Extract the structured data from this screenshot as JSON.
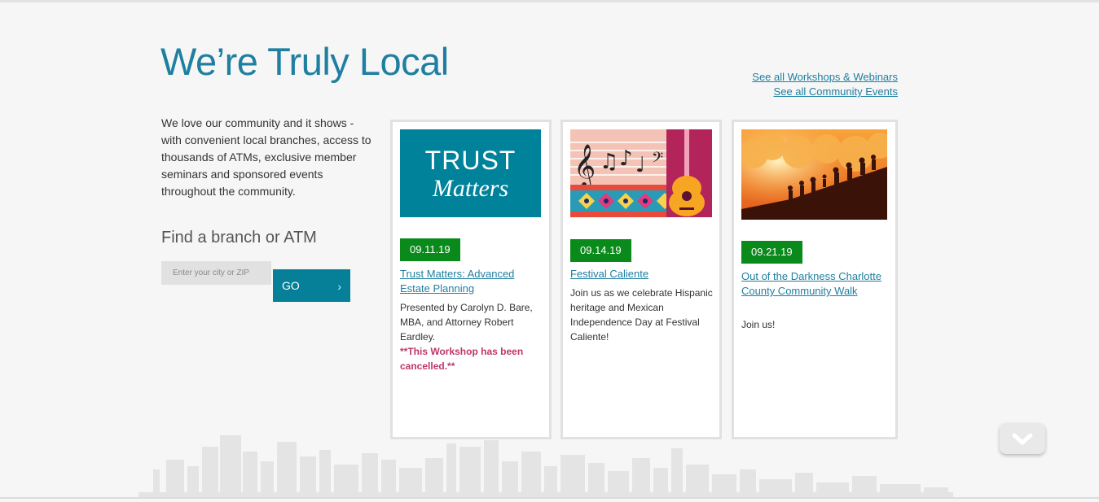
{
  "section": {
    "title": "We’re Truly Local",
    "intro": "We love our community and it shows - with convenient local branches, access to thousands of ATMs, exclusive member seminars and sponsored events throughout the community."
  },
  "links": {
    "workshops": "See all Workshops & Webinars",
    "community_events": "See all Community Events"
  },
  "branch_finder": {
    "heading": "Find a branch or ATM",
    "placeholder": "Enter your city or ZIP",
    "go_label": "GO",
    "go_icon": "chevron-right-icon"
  },
  "events": [
    {
      "image_text_top": "TRUST",
      "image_text_script": "Matters",
      "date": "09.11.19",
      "title": "Trust Matters: Advanced Estate Planning",
      "description": "Presented by Carolyn D. Bare, MBA, and Attorney Robert Eardley.",
      "note": "**This Workshop has been cancelled.**"
    },
    {
      "date": "09.14.19",
      "title": "Festival Caliente",
      "description": "Join us as we celebrate Hispanic heritage and Mexican Independence Day at Festival Caliente!"
    },
    {
      "date": "09.21.19",
      "title": "Out of the Darkness Charlotte County Community Walk",
      "description": "Join us!"
    }
  ],
  "scroll_button": {
    "icon": "chevron-down-icon"
  },
  "colors": {
    "accent": "#1f7fa0",
    "go_button": "#067f99",
    "badge": "#0a8a1a",
    "cancel": "#c0356a",
    "trust_bg": "#00829b"
  }
}
